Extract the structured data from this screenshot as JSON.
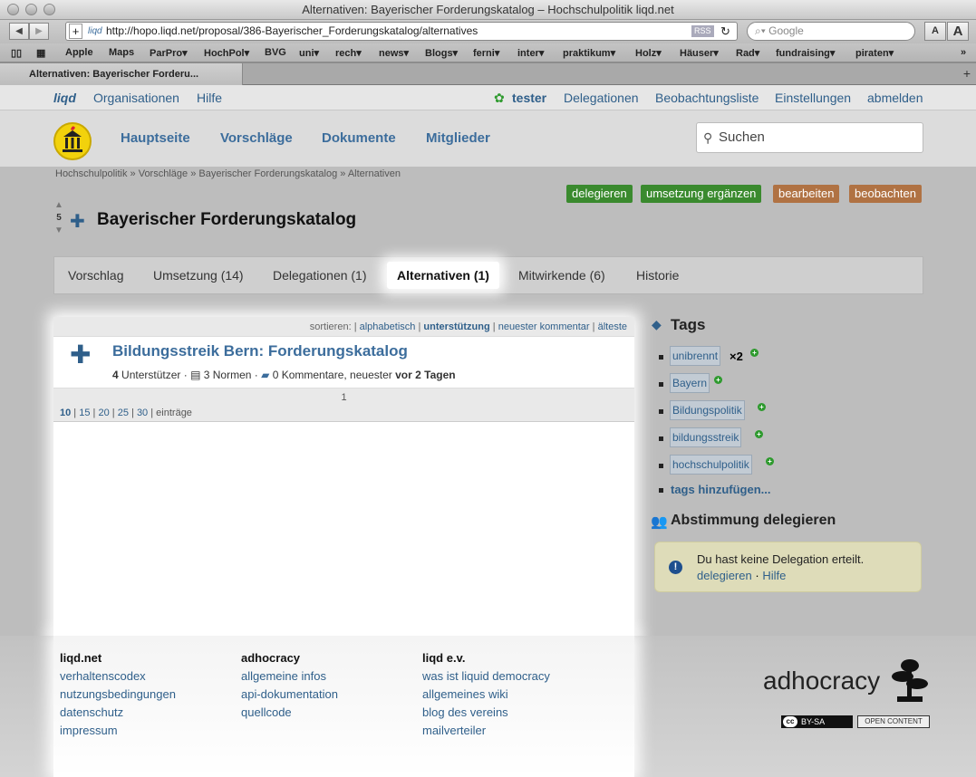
{
  "window": {
    "title": "Alternativen: Bayerischer Forderungskatalog – Hochschulpolitik liqd.net"
  },
  "toolbar": {
    "url_prefix": "liqd",
    "url": "http://hopo.liqd.net/proposal/386-Bayerischer_Forderungskatalog/alternatives",
    "rss": "RSS",
    "search_placeholder": "Google",
    "font_small": "A",
    "font_large": "A"
  },
  "bookmarks": [
    "Apple",
    "Maps",
    "ParPro▾",
    "HochPol▾",
    "BVG",
    "uni▾",
    "rech▾",
    "news▾",
    "Blogs▾",
    "ferni▾",
    "inter▾",
    "praktikum▾",
    "Holz▾",
    "Häuser▾",
    "Rad▾",
    "fundraising▾",
    "piraten▾"
  ],
  "browser_tab": {
    "label": "Alternativen: Bayerischer Forderu..."
  },
  "topbar": {
    "logo": "liqd",
    "org": "Organisationen",
    "help": "Hilfe",
    "user": "tester",
    "delegations": "Delegationen",
    "watchlist": "Beobachtungsliste",
    "settings": "Einstellungen",
    "logout": "abmelden"
  },
  "nav": {
    "home": "Hauptseite",
    "proposals": "Vorschläge",
    "documents": "Dokumente",
    "members": "Mitglieder",
    "search": "Suchen"
  },
  "breadcrumb": "Hochschulpolitik » Vorschläge » Bayerischer Forderungskatalog » Alternativen",
  "actions": {
    "delegate": "delegieren",
    "implement": "umsetzung ergänzen",
    "edit": "bearbeiten",
    "watch": "beobachten"
  },
  "proposal": {
    "votes": "5",
    "title": "Bayerischer Forderungskatalog"
  },
  "tabs": {
    "proposal": "Vorschlag",
    "implementation": "Umsetzung (14)",
    "delegations": "Delegationen (1)",
    "alternatives": "Alternativen (1)",
    "contributors": "Mitwirkende (6)",
    "history": "Historie"
  },
  "sort": {
    "label": "sortieren:",
    "alpha": "alphabetisch",
    "support": "unterstützung",
    "newest": "neuester kommentar",
    "oldest": "älteste"
  },
  "item": {
    "title": "Bildungsstreik Bern: Forderungskatalog",
    "supporters_n": "4",
    "supporters": "Unterstützer",
    "norms": "3 Normen",
    "comments": "0 Kommentare, neuester",
    "age": "vor 2 Tagen"
  },
  "pager": {
    "page": "1",
    "sizes": [
      "10",
      "15",
      "20",
      "25",
      "30"
    ],
    "entries": "einträge"
  },
  "tags": {
    "title": "Tags",
    "items": [
      {
        "name": "unibrennt",
        "count": "×2"
      },
      {
        "name": "Bayern",
        "count": ""
      },
      {
        "name": "Bildungspolitik",
        "count": ""
      },
      {
        "name": "bildungsstreik",
        "count": ""
      },
      {
        "name": "hochschulpolitik",
        "count": ""
      }
    ],
    "add": "tags hinzufügen..."
  },
  "delegation": {
    "title": "Abstimmung delegieren",
    "msg": "Du hast keine Delegation erteilt.",
    "delegate": "delegieren",
    "help": "Hilfe",
    "sep": "·"
  },
  "footer": {
    "col1": {
      "title": "liqd.net",
      "links": [
        "verhaltenscodex",
        "nutzungsbedingungen",
        "datenschutz",
        "impressum"
      ]
    },
    "col2": {
      "title": "adhocracy",
      "links": [
        "allgemeine infos",
        "api-dokumentation",
        "quellcode"
      ]
    },
    "col3": {
      "title": "liqd e.v.",
      "links": [
        "was ist liquid democracy",
        "allgemeines wiki",
        "blog des vereins",
        "mailverteiler"
      ]
    },
    "brand": "adhocracy",
    "cc": "BY-SA",
    "open": "OPEN CONTENT"
  },
  "colors": {
    "accent": "#3c6d9c",
    "green": "#3a8a2e",
    "brown": "#b07243"
  }
}
